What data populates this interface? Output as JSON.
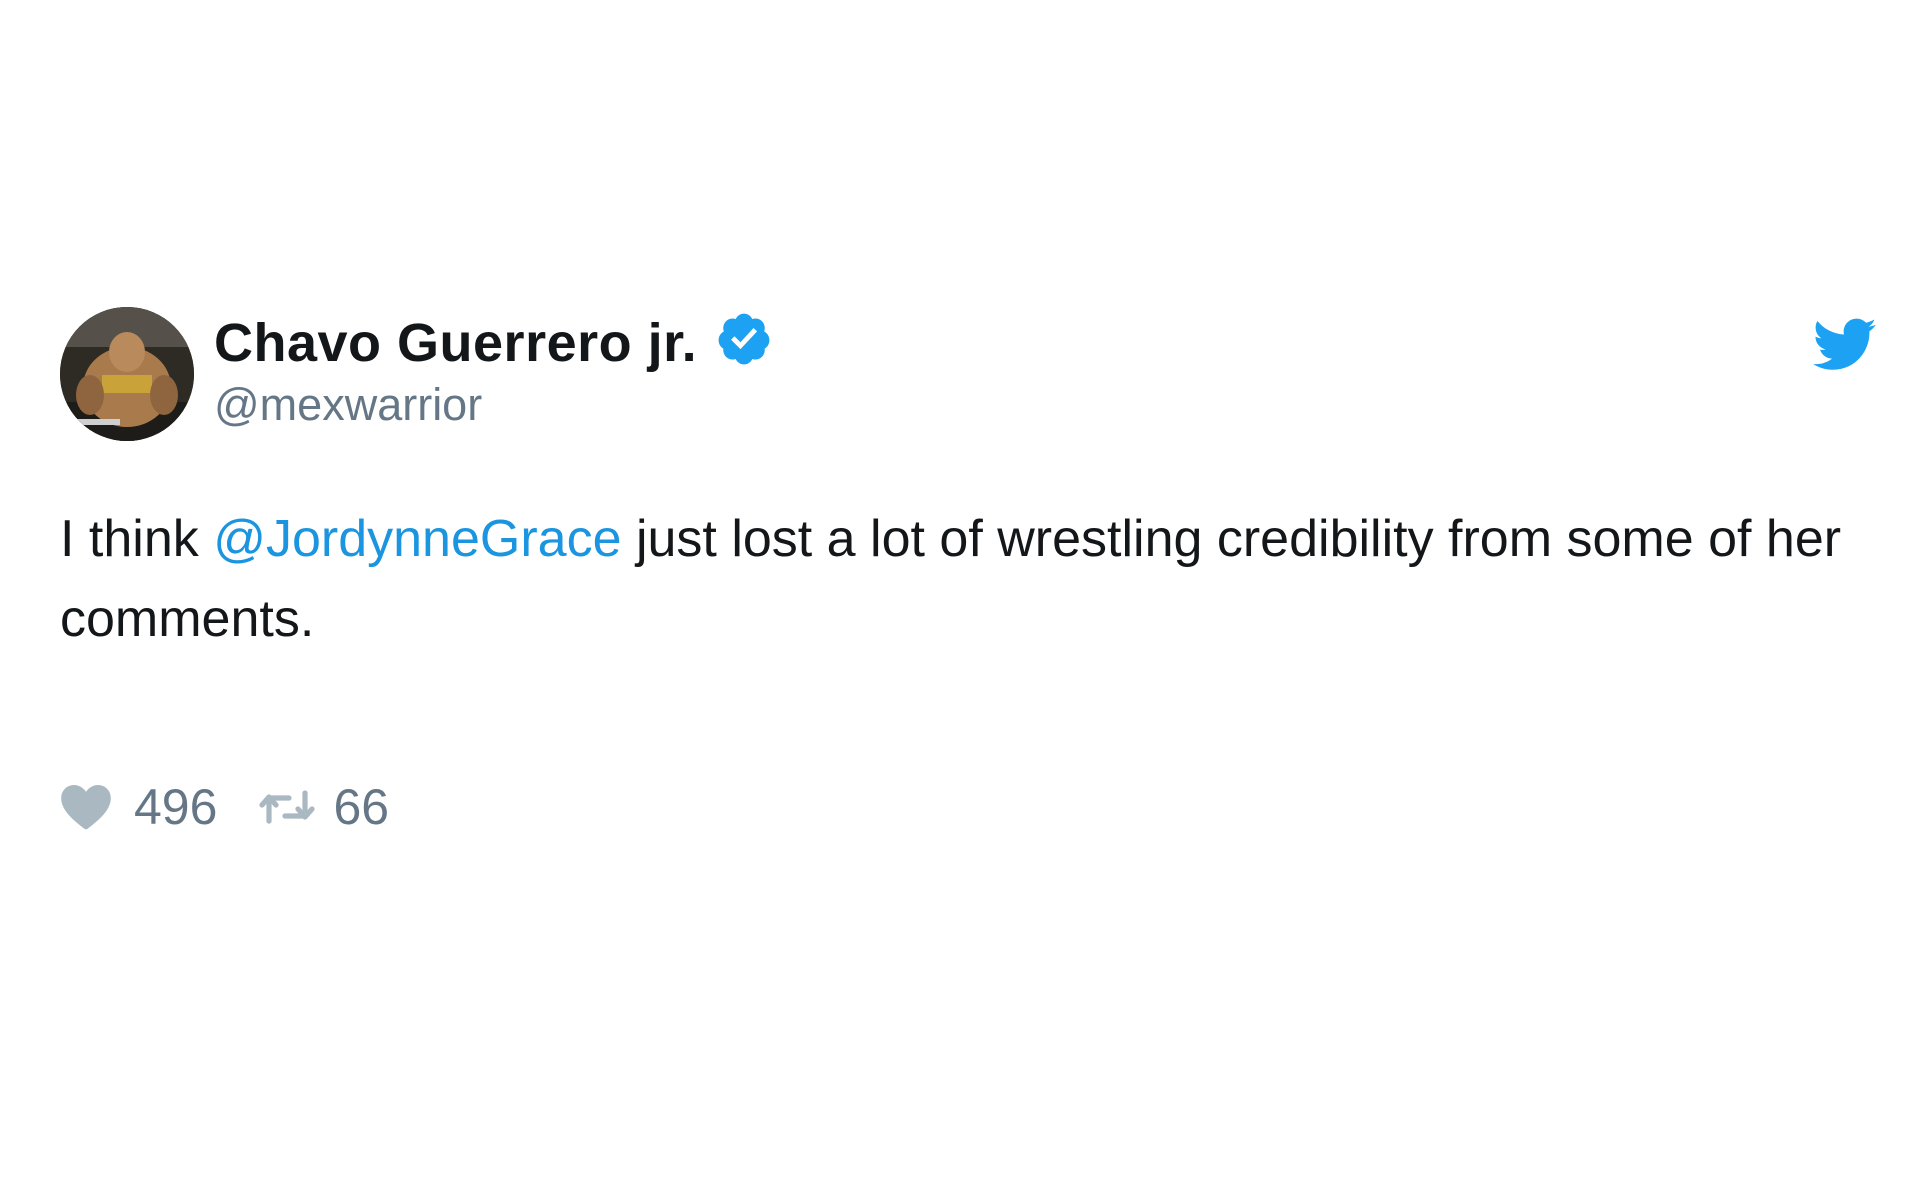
{
  "tweet": {
    "display_name": "Chavo Guerrero jr.",
    "handle": "@mexwarrior",
    "verified": true,
    "text_before": "I think ",
    "mention": "@JordynneGrace",
    "text_after": " just lost a lot of wrestling credibility from some of her comments.",
    "likes": "496",
    "retweets": "66"
  },
  "icons": {
    "verified": "verified-badge-icon",
    "platform": "twitter-bird-icon",
    "like": "heart-icon",
    "retweet": "retweet-icon"
  },
  "colors": {
    "accent": "#1da1f2",
    "mention": "#1b95e0",
    "text": "#14171a",
    "muted": "#657786"
  }
}
